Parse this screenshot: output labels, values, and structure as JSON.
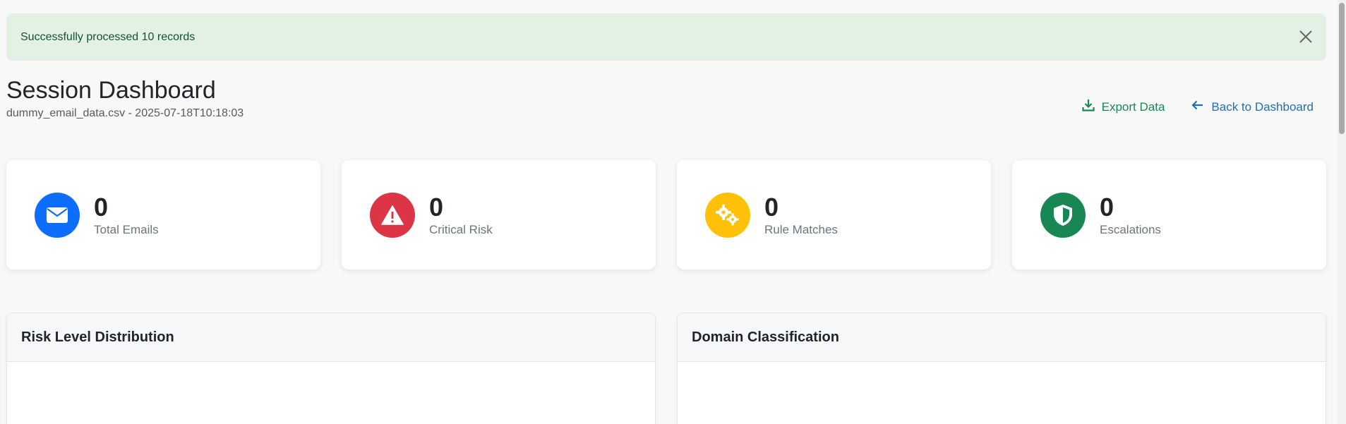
{
  "alert": {
    "message": "Successfully processed 10 records",
    "close_icon": "close-icon"
  },
  "header": {
    "title": "Session Dashboard",
    "subtitle": "dummy_email_data.csv - 2025-07-18T10:18:03",
    "export_label": "Export Data",
    "export_icon": "download-icon",
    "back_label": "Back to Dashboard",
    "back_icon": "arrow-left-icon"
  },
  "stats": [
    {
      "value": "0",
      "label": "Total Emails",
      "icon": "envelope-icon",
      "color": "#0d6efd"
    },
    {
      "value": "0",
      "label": "Critical Risk",
      "icon": "warning-triangle-icon",
      "color": "#dc3545"
    },
    {
      "value": "0",
      "label": "Rule Matches",
      "icon": "gears-icon",
      "color": "#ffc107"
    },
    {
      "value": "0",
      "label": "Escalations",
      "icon": "shield-icon",
      "color": "#198754"
    }
  ],
  "panels": [
    {
      "title": "Risk Level Distribution"
    },
    {
      "title": "Domain Classification"
    }
  ],
  "colors": {
    "alert_bg": "#e3f1e5",
    "alert_text": "#14532d",
    "export": "#198754",
    "back": "#1f6fb2"
  }
}
